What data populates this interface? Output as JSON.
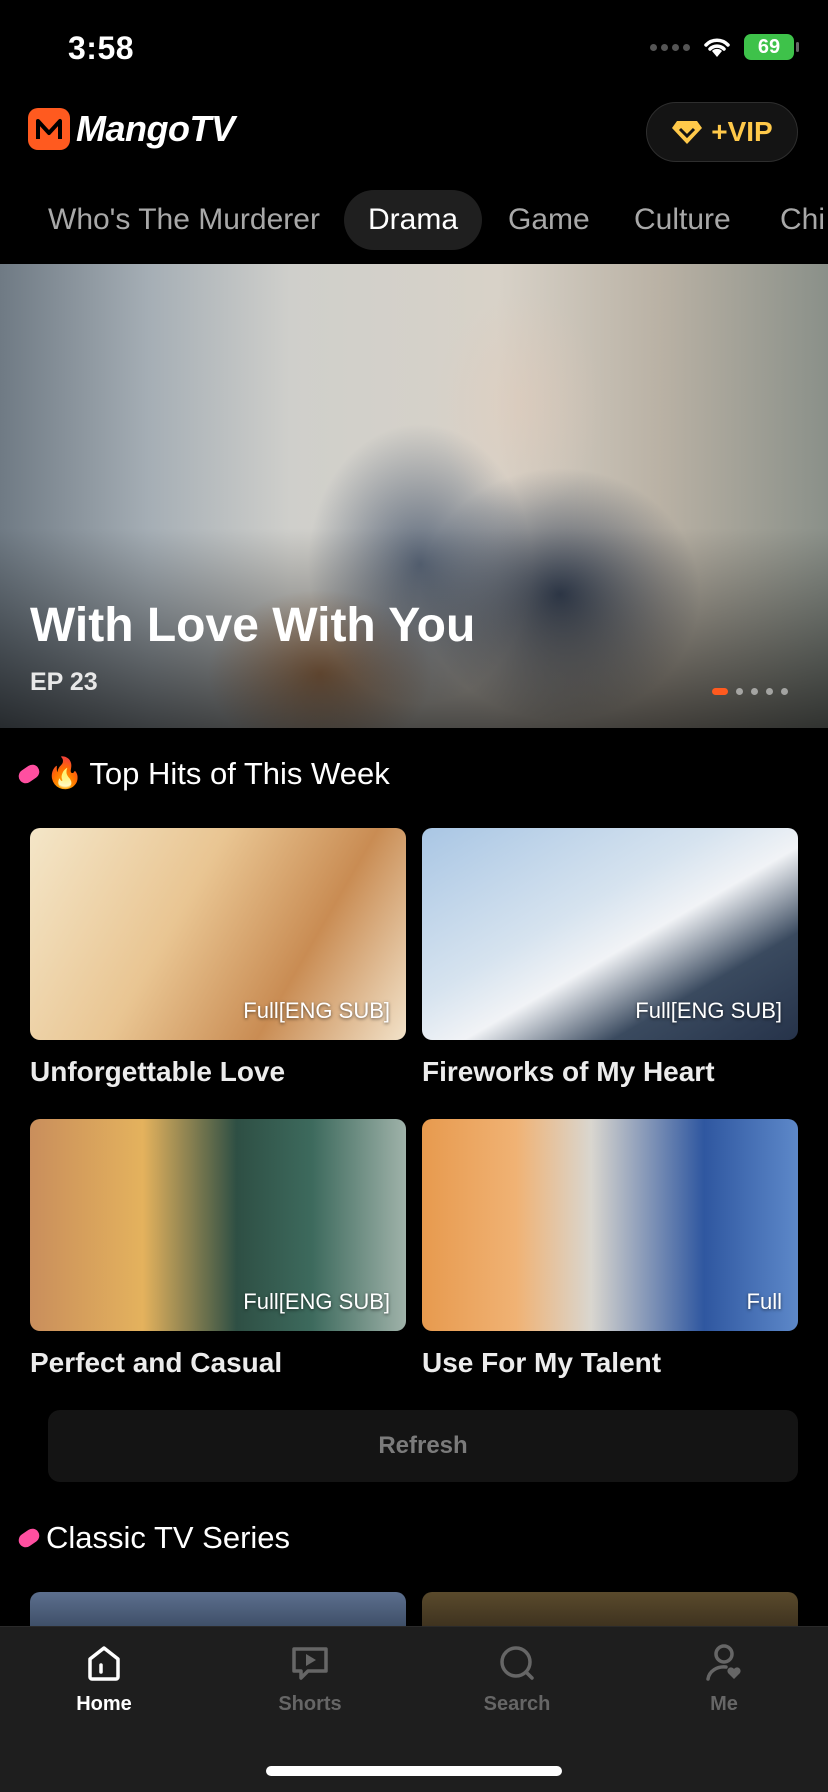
{
  "status_bar": {
    "time": "3:58",
    "battery": "69",
    "icons": [
      "signal-dots-icon",
      "wifi-icon",
      "battery-icon"
    ]
  },
  "header": {
    "logo_text": "MangoTV",
    "vip_label": "+VIP",
    "icons": [
      "mango-logo-icon",
      "vip-diamond-icon"
    ]
  },
  "tabs": [
    {
      "label": "Who's The Murderer",
      "active": false
    },
    {
      "label": "Drama",
      "active": true
    },
    {
      "label": "Game",
      "active": false
    },
    {
      "label": "Culture",
      "active": false
    },
    {
      "label": "Chi",
      "active": false
    }
  ],
  "hero": {
    "title": "With Love With You",
    "episode": "EP 23",
    "slide_count": 5,
    "active_slide": 1
  },
  "top_hits": {
    "title": "Top Hits of This Week",
    "items": [
      {
        "title": "Unforgettable Love",
        "badge": "Full[ENG SUB]"
      },
      {
        "title": "Fireworks of My Heart",
        "badge": "Full[ENG SUB]"
      },
      {
        "title": "Perfect and Casual",
        "badge": "Full[ENG SUB]"
      },
      {
        "title": "Use For My Talent",
        "badge": "Full"
      }
    ],
    "refresh_label": "Refresh"
  },
  "classic": {
    "title": "Classic TV Series"
  },
  "bottom_nav": [
    {
      "label": "Home",
      "icon": "home-icon",
      "active": true
    },
    {
      "label": "Shorts",
      "icon": "play-icon",
      "active": false
    },
    {
      "label": "Search",
      "icon": "search-icon",
      "active": false
    },
    {
      "label": "Me",
      "icon": "profile-icon",
      "active": false
    }
  ],
  "colors": {
    "accent": "#ff5a1f",
    "vip_gold": "#ffc94a",
    "battery_green": "#3ec24a",
    "background": "#000000",
    "nav_background": "#1e1e1e"
  }
}
